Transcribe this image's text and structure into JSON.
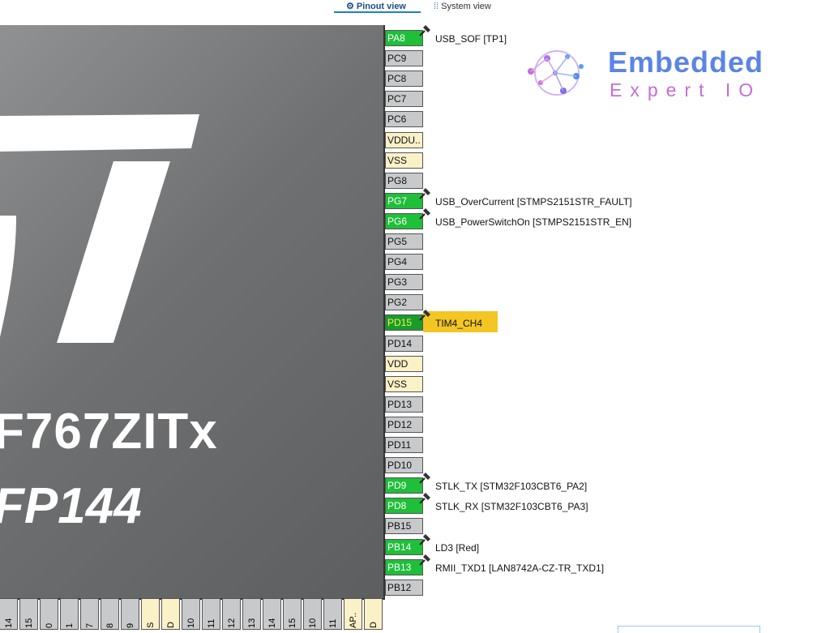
{
  "tabs": {
    "pinout": "Pinout view",
    "system": "System view"
  },
  "chip": {
    "name": "F767ZITx",
    "package": "FP144"
  },
  "right_pins": [
    {
      "pin": "PA8",
      "state": "green",
      "label": "USB_SOF [TP1]"
    },
    {
      "pin": "PC9",
      "state": "gray",
      "label": ""
    },
    {
      "pin": "PC8",
      "state": "gray",
      "label": ""
    },
    {
      "pin": "PC7",
      "state": "gray",
      "label": ""
    },
    {
      "pin": "PC6",
      "state": "gray",
      "label": ""
    },
    {
      "pin": "VDDU..",
      "state": "power",
      "label": ""
    },
    {
      "pin": "VSS",
      "state": "power",
      "label": ""
    },
    {
      "pin": "PG8",
      "state": "gray",
      "label": ""
    },
    {
      "pin": "PG7",
      "state": "green",
      "label": "USB_OverCurrent [STMPS2151STR_FAULT]"
    },
    {
      "pin": "PG6",
      "state": "green",
      "label": "USB_PowerSwitchOn [STMPS2151STR_EN]"
    },
    {
      "pin": "PG5",
      "state": "gray",
      "label": ""
    },
    {
      "pin": "PG4",
      "state": "gray",
      "label": ""
    },
    {
      "pin": "PG3",
      "state": "gray",
      "label": ""
    },
    {
      "pin": "PG2",
      "state": "gray",
      "label": ""
    },
    {
      "pin": "PD15",
      "state": "sel",
      "label": "TIM4_CH4"
    },
    {
      "pin": "PD14",
      "state": "gray",
      "label": ""
    },
    {
      "pin": "VDD",
      "state": "power",
      "label": ""
    },
    {
      "pin": "VSS",
      "state": "power",
      "label": ""
    },
    {
      "pin": "PD13",
      "state": "gray",
      "label": ""
    },
    {
      "pin": "PD12",
      "state": "gray",
      "label": ""
    },
    {
      "pin": "PD11",
      "state": "gray",
      "label": ""
    },
    {
      "pin": "PD10",
      "state": "gray",
      "label": ""
    },
    {
      "pin": "PD9",
      "state": "green",
      "label": "STLK_TX [STM32F103CBT6_PA2]"
    },
    {
      "pin": "PD8",
      "state": "green",
      "label": "STLK_RX [STM32F103CBT6_PA3]"
    },
    {
      "pin": "PB15",
      "state": "gray",
      "label": ""
    },
    {
      "pin": "PB14",
      "state": "green",
      "label": "LD3 [Red]"
    },
    {
      "pin": "PB13",
      "state": "green",
      "label": "RMII_TXD1 [LAN8742A-CZ-TR_TXD1]"
    },
    {
      "pin": "PB12",
      "state": "gray",
      "label": ""
    }
  ],
  "bottom_pins": [
    {
      "pin": "14",
      "state": "gray"
    },
    {
      "pin": "15",
      "state": "gray"
    },
    {
      "pin": "0",
      "state": "gray"
    },
    {
      "pin": "1",
      "state": "gray"
    },
    {
      "pin": "7",
      "state": "gray"
    },
    {
      "pin": "8",
      "state": "gray"
    },
    {
      "pin": "9",
      "state": "gray"
    },
    {
      "pin": "S",
      "state": "power"
    },
    {
      "pin": "D",
      "state": "power"
    },
    {
      "pin": "10",
      "state": "gray"
    },
    {
      "pin": "11",
      "state": "gray"
    },
    {
      "pin": "12",
      "state": "gray"
    },
    {
      "pin": "13",
      "state": "gray"
    },
    {
      "pin": "14",
      "state": "gray"
    },
    {
      "pin": "15",
      "state": "gray"
    },
    {
      "pin": "10",
      "state": "gray"
    },
    {
      "pin": "11",
      "state": "gray"
    },
    {
      "pin": "AP..",
      "state": "power"
    },
    {
      "pin": "D",
      "state": "power"
    }
  ],
  "logo": {
    "line1": "Embedded",
    "line2": "Expert IO"
  },
  "colors": {
    "pin_assigned": "#1fbf3a",
    "pin_selected": "#189c2c",
    "pin_free": "#c7c9cb",
    "pin_power": "#fbf1c7",
    "highlight": "#f3c623",
    "tab_accent": "#1b7fd1"
  },
  "icons": {
    "pinout_tab": "chip-icon",
    "system_tab": "grid-icon",
    "pin_lock": "pushpin-icon"
  }
}
